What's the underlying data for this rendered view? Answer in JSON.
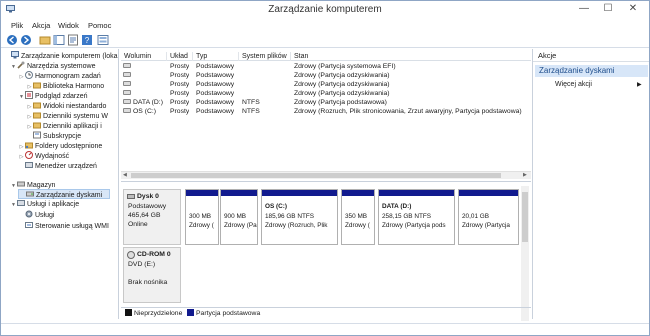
{
  "window": {
    "title": "Zarządzanie komputerem",
    "controls": [
      "—",
      "☐",
      "✕"
    ]
  },
  "menu": [
    {
      "label": "Plik",
      "key": "P"
    },
    {
      "label": "Akcja",
      "key": "A"
    },
    {
      "label": "Widok",
      "key": "W"
    },
    {
      "label": "Pomoc",
      "key": "o"
    }
  ],
  "toolbar": [
    "back-arrow-icon",
    "forward-arrow-icon",
    "up-folder-icon",
    "console-tree-icon",
    "properties-icon",
    "help-icon",
    "view-icon"
  ],
  "tree": [
    {
      "label": "Zarządzanie komputerem (loka",
      "level": 0,
      "exp": "",
      "icon": "computer-icon"
    },
    {
      "label": "Narzędzia systemowe",
      "level": 1,
      "exp": "▼",
      "icon": "tools-icon"
    },
    {
      "label": "Harmonogram zadań",
      "level": 2,
      "exp": "▷",
      "icon": "clock-icon"
    },
    {
      "label": "Biblioteka Harmono",
      "level": 3,
      "exp": "▷",
      "icon": "folder-icon"
    },
    {
      "label": "Podgląd zdarzeń",
      "level": 2,
      "exp": "▼",
      "icon": "event-icon"
    },
    {
      "label": "Widoki niestandardo",
      "level": 3,
      "exp": "▷",
      "icon": "folder-icon"
    },
    {
      "label": "Dzienniki systemu W",
      "level": 3,
      "exp": "▷",
      "icon": "folder-icon"
    },
    {
      "label": "Dzienniki aplikacji i ",
      "level": 3,
      "exp": "▷",
      "icon": "folder-icon"
    },
    {
      "label": "Subskrypcje",
      "level": 3,
      "exp": "",
      "icon": "subscription-icon"
    },
    {
      "label": "Foldery udostępnione",
      "level": 2,
      "exp": "▷",
      "icon": "shared-folder-icon"
    },
    {
      "label": "Wydajność",
      "level": 2,
      "exp": "▷",
      "icon": "performance-icon"
    },
    {
      "label": "Menedżer urządzeń",
      "level": 2,
      "exp": "",
      "icon": "device-icon"
    },
    {
      "label": "Magazyn",
      "level": 1,
      "exp": "▼",
      "icon": "storage-icon"
    },
    {
      "label": "Zarządzanie dyskami",
      "level": 2,
      "exp": "",
      "icon": "disk-icon",
      "selected": true
    },
    {
      "label": "Usługi i aplikacje",
      "level": 1,
      "exp": "▼",
      "icon": "services-icon"
    },
    {
      "label": "Usługi",
      "level": 2,
      "exp": "",
      "icon": "gear-icon"
    },
    {
      "label": "Sterowanie usługą WMI",
      "level": 2,
      "exp": "",
      "icon": "wmi-icon"
    }
  ],
  "volumes": {
    "headers": [
      "Wolumin",
      "Układ",
      "Typ",
      "System plików",
      "Stan"
    ],
    "rows": [
      [
        "",
        "Prosty",
        "Podstawowy",
        "",
        "Zdrowy (Partycja systemowa EFI)"
      ],
      [
        "",
        "Prosty",
        "Podstawowy",
        "",
        "Zdrowy (Partycja odzyskiwania)"
      ],
      [
        "",
        "Prosty",
        "Podstawowy",
        "",
        "Zdrowy (Partycja odzyskiwania)"
      ],
      [
        "",
        "Prosty",
        "Podstawowy",
        "",
        "Zdrowy (Partycja odzyskiwania)"
      ],
      [
        "DATA (D:)",
        "Prosty",
        "Podstawowy",
        "NTFS",
        "Zdrowy (Partycja podstawowa)"
      ],
      [
        "OS (C:)",
        "Prosty",
        "Podstawowy",
        "NTFS",
        "Zdrowy (Rozruch, Plik stronicowania, Zrzut awaryjny, Partycja podstawowa)"
      ]
    ]
  },
  "disks": [
    {
      "name": "Dysk 0",
      "lines": [
        "Podstawowy",
        "465,64 GB",
        "Online"
      ],
      "partitions": [
        {
          "title": "",
          "size": "300 MB",
          "status": "Zdrowy ("
        },
        {
          "title": "",
          "size": "900 MB",
          "status": "Zdrowy (Pa"
        },
        {
          "title": "OS  (C:)",
          "size": "185,96 GB NTFS",
          "status": "Zdrowy (Rozruch, Plik"
        },
        {
          "title": "",
          "size": "350 MB",
          "status": "Zdrowy ("
        },
        {
          "title": "DATA  (D:)",
          "size": "258,15 GB NTFS",
          "status": "Zdrowy (Partycja pods"
        },
        {
          "title": "",
          "size": "20,01 GB",
          "status": "Zdrowy (Partycja"
        }
      ]
    },
    {
      "name": "CD-ROM 0",
      "lines": [
        "DVD (E:)",
        "",
        "Brak nośnika"
      ]
    }
  ],
  "legend": [
    {
      "label": "Nieprzydzielone",
      "color": "#111111"
    },
    {
      "label": "Partycja podstawowa",
      "color": "#111a8e"
    }
  ],
  "actions": {
    "header": "Akcje",
    "section": "Zarządzanie dyskami",
    "items": [
      {
        "label": "Więcej akcji"
      }
    ]
  }
}
